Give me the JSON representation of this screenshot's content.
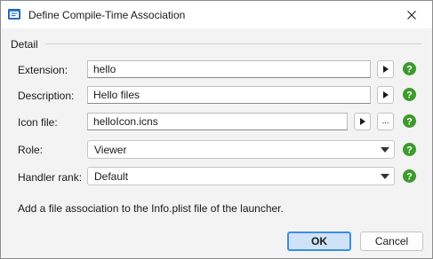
{
  "window": {
    "title": "Define Compile-Time Association",
    "title_icon": "app-window-icon",
    "close_icon": "close-icon"
  },
  "section": {
    "label": "Detail"
  },
  "fields": {
    "extension": {
      "label": "Extension:",
      "value": "hello"
    },
    "description": {
      "label": "Description:",
      "value": "Hello files"
    },
    "icon_file": {
      "label": "Icon file:",
      "value": "helloIcon.icns",
      "browse_label": "..."
    }
  },
  "selects": {
    "role": {
      "label": "Role:",
      "value": "Viewer"
    },
    "handler_rank": {
      "label": "Handler rank:",
      "value": "Default"
    }
  },
  "help_icon": "help-question-icon",
  "help_text": "?",
  "note": "Add a file association to the Info.plist file of the launcher.",
  "buttons": {
    "ok": "OK",
    "cancel": "Cancel"
  },
  "colors": {
    "accent": "#3b8ee0",
    "help_green": "#3d9a2c",
    "ok_background": "#cfe2f7"
  }
}
